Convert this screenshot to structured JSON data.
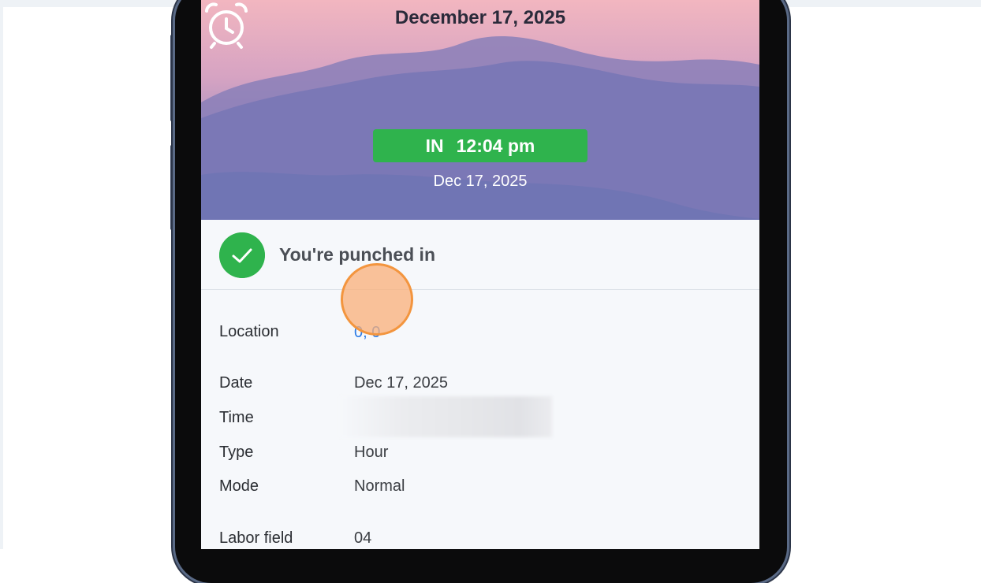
{
  "header": {
    "date": "December 17, 2025",
    "alarm_icon": "alarm-clock-icon",
    "punch": {
      "direction": "IN",
      "time": "12:04 pm"
    },
    "punch_date": "Dec 17, 2025"
  },
  "status": {
    "icon": "check-circle-icon",
    "text": "You're punched in",
    "color": "#2fb34d"
  },
  "details": {
    "location": {
      "label": "Location",
      "value": "0, 0"
    },
    "date": {
      "label": "Date",
      "value": "Dec 17, 2025"
    },
    "time": {
      "label": "Time",
      "value": ""
    },
    "type": {
      "label": "Type",
      "value": "Hour"
    },
    "mode": {
      "label": "Mode",
      "value": "Normal"
    },
    "labor_field": {
      "label": "Labor field",
      "value": "04"
    }
  }
}
